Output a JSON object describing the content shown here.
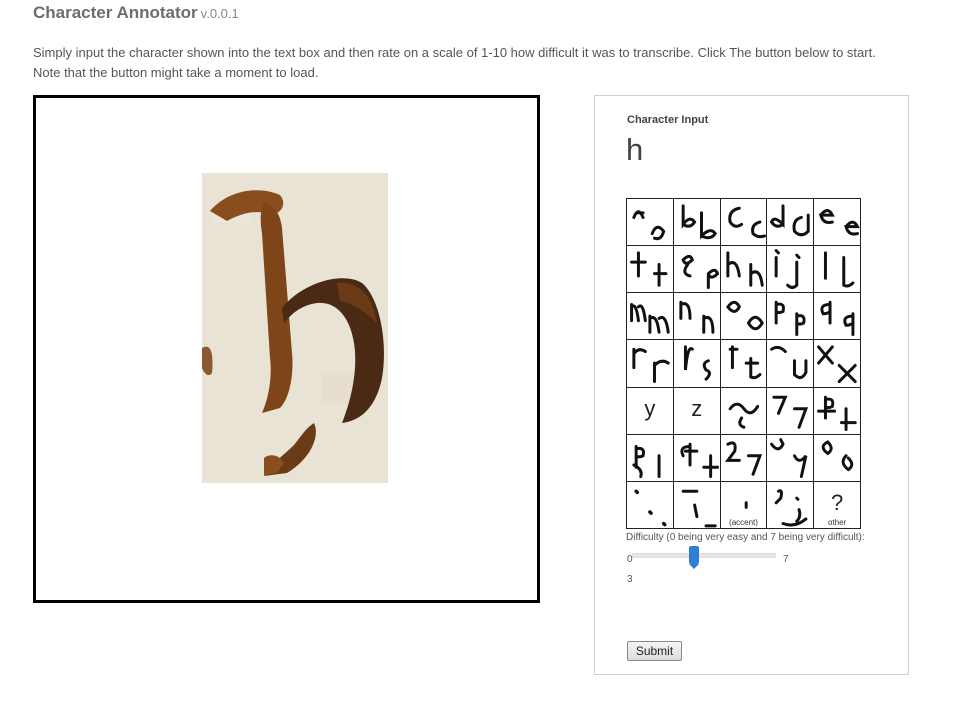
{
  "app": {
    "title": "Character Annotator",
    "version": "v.0.0.1"
  },
  "instructions": {
    "line1": "Simply input the character shown into the text box and then rate on a scale of 1-10 how difficult it was to transcribe. Click The button below to start.",
    "line2": "Note that the button might take a moment to load."
  },
  "panel": {
    "input_label": "Character Input",
    "input_value": "h",
    "grid": {
      "cells": [
        {
          "id": "a",
          "plain": ""
        },
        {
          "id": "b",
          "plain": ""
        },
        {
          "id": "c",
          "plain": ""
        },
        {
          "id": "d",
          "plain": ""
        },
        {
          "id": "e",
          "plain": ""
        },
        {
          "id": "f",
          "plain": ""
        },
        {
          "id": "g",
          "plain": ""
        },
        {
          "id": "h",
          "plain": ""
        },
        {
          "id": "i-j",
          "plain": ""
        },
        {
          "id": "l",
          "plain": ""
        },
        {
          "id": "m",
          "plain": ""
        },
        {
          "id": "n",
          "plain": ""
        },
        {
          "id": "o",
          "plain": ""
        },
        {
          "id": "p",
          "plain": ""
        },
        {
          "id": "q",
          "plain": ""
        },
        {
          "id": "r",
          "plain": ""
        },
        {
          "id": "s",
          "plain": ""
        },
        {
          "id": "t",
          "plain": ""
        },
        {
          "id": "u",
          "plain": ""
        },
        {
          "id": "x",
          "plain": ""
        },
        {
          "id": "y",
          "plain": "y"
        },
        {
          "id": "z",
          "plain": "z"
        },
        {
          "id": "tilde",
          "plain": ""
        },
        {
          "id": "et",
          "plain": ""
        },
        {
          "id": "per",
          "plain": ""
        },
        {
          "id": "pro",
          "plain": ""
        },
        {
          "id": "quod",
          "plain": ""
        },
        {
          "id": "rum",
          "plain": ""
        },
        {
          "id": "vel",
          "plain": ""
        },
        {
          "id": "con",
          "plain": ""
        },
        {
          "id": "dots",
          "plain": ""
        },
        {
          "id": "dash",
          "plain": ""
        },
        {
          "id": "accent",
          "plain": "",
          "caption": "(accent)"
        },
        {
          "id": "semicolon",
          "plain": ""
        },
        {
          "id": "other",
          "plain": "?",
          "caption": "other"
        }
      ]
    },
    "difficulty": {
      "label": "Difficulty (0 being very easy and 7 being very difficult):",
      "min": "0",
      "max": "7",
      "value": 3,
      "value_text": "3"
    },
    "submit_label": "Submit"
  },
  "colors": {
    "slider_handle": "#2f7fd8",
    "frame_border": "#000000",
    "panel_border": "#cfcfcf"
  }
}
